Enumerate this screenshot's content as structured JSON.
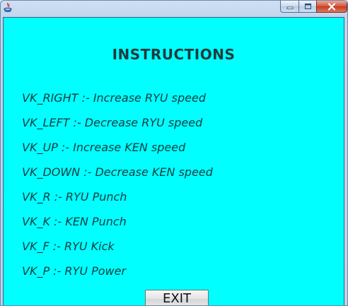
{
  "window": {
    "controls": [
      "minimize",
      "maximize",
      "close"
    ],
    "icon": "java-icon"
  },
  "panel": {
    "background": "#00ffff",
    "title": "INSTRUCTIONS",
    "instructions": [
      "VK_RIGHT :- Increase RYU speed",
      "VK_LEFT :- Decrease RYU speed",
      "VK_UP :- Increase KEN speed",
      "VK_DOWN :- Decrease KEN speed",
      "VK_R :- RYU Punch",
      "VK_K :- KEN Punch",
      "VK_F :- RYU Kick",
      "VK_P :- RYU Power"
    ],
    "exit_label": "EXIT"
  }
}
